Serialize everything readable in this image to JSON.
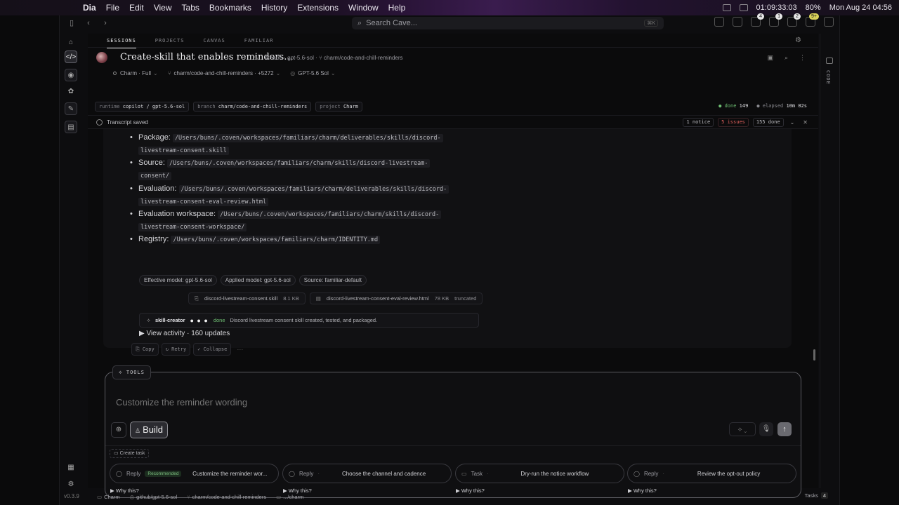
{
  "menubar": {
    "menus": [
      "Dia",
      "File",
      "Edit",
      "View",
      "Tabs",
      "Bookmarks",
      "History",
      "Extensions",
      "Window",
      "Help"
    ],
    "timer": "01:09:33:03",
    "battery": "80%",
    "datetime": "Mon Aug 24  04:56"
  },
  "toolbar": {
    "search_placeholder": "Search Cave...",
    "search_shortcut": "⌘K",
    "badges": [
      "4",
      "1",
      "2",
      "9+"
    ]
  },
  "tabs": [
    "SESSIONS",
    "PROJECTS",
    "CANVAS",
    "FAMILIAR"
  ],
  "session": {
    "title": "Create-skill that enables reminders...",
    "meta": "Charm · gpt-5.6-sol · ⑂ charm/code-and-chill-reminders",
    "agent": "Charm · Full",
    "branch": "charm/code-and-chill-reminders · +5272",
    "model": "GPT-5.6 Sol"
  },
  "chips": [
    {
      "key": "runtime",
      "value": "copilot / gpt-5.6-sol"
    },
    {
      "key": "branch",
      "value": "charm/code-and-chill-reminders"
    },
    {
      "key": "project",
      "value": "Charm"
    }
  ],
  "status": {
    "done_label": "● done",
    "done_value": "149",
    "elapsed_label": "● elapsed",
    "elapsed_value": "10m 02s"
  },
  "notice": {
    "text": "Transcript saved",
    "notice_count": "1 notice",
    "issues_count": "5 issues",
    "done_count": "155 done"
  },
  "transcript": {
    "items": [
      {
        "label": "Package:",
        "path1": "/Users/buns/.coven/workspaces/familiars/charm/deliverables/skills/discord-",
        "path2": "livestream-consent.skill"
      },
      {
        "label": "Source:",
        "path1": "/Users/buns/.coven/workspaces/familiars/charm/skills/discord-livestream-",
        "path2": "consent/"
      },
      {
        "label": "Evaluation:",
        "path1": "/Users/buns/.coven/workspaces/familiars/charm/deliverables/skills/discord-",
        "path2": "livestream-consent-eval-review.html"
      },
      {
        "label": "Evaluation workspace:",
        "path1": "/Users/buns/.coven/workspaces/familiars/charm/skills/discord-",
        "path2": "livestream-consent-workspace/"
      },
      {
        "label": "Registry:",
        "path1": "/Users/buns/.coven/workspaces/familiars/charm/IDENTITY.md",
        "path2": ""
      }
    ],
    "tags": [
      "Effective model: gpt-5.6-sol",
      "Applied model: gpt-5.6-sol",
      "Source: familiar-default"
    ],
    "files": [
      {
        "name": "discord-livestream-consent.skill",
        "size": "8.1 KB",
        "note": ""
      },
      {
        "name": "discord-livestream-consent-eval-review.html",
        "size": "78 KB",
        "note": "truncated"
      }
    ],
    "skill": {
      "name": "skill-creator",
      "dots": "● ● ●",
      "state": "done",
      "message": "Discord livestream consent skill created, tested, and packaged."
    },
    "view_activity": "▶ View activity · 160 updates",
    "actions": [
      "Copy",
      "Retry",
      "Collapse"
    ]
  },
  "composer": {
    "tools_label": "TOOLS",
    "placeholder": "Customize the reminder wording",
    "mode_label": "Build",
    "create_task": "Create task",
    "suggestions": [
      {
        "kind": "Reply",
        "badge": "Recommended",
        "text": "Customize the reminder wor..."
      },
      {
        "kind": "Reply",
        "badge": "",
        "text": "Choose the channel and cadence"
      },
      {
        "kind": "Task",
        "badge": "",
        "text": "Dry-run the notice workflow"
      },
      {
        "kind": "Reply",
        "badge": "",
        "text": "Review the opt-out policy"
      }
    ],
    "why": "▶ Why this?"
  },
  "bottombar": {
    "items": [
      "Charm",
      "github/gpt-5.6-sol",
      "charm/code-and-chill-reminders",
      ".../charm"
    ],
    "tasks_label": "Tasks",
    "tasks_count": "4"
  },
  "rail": {
    "version": "v0.3.9"
  },
  "right_rail": {
    "label": "CODE"
  }
}
